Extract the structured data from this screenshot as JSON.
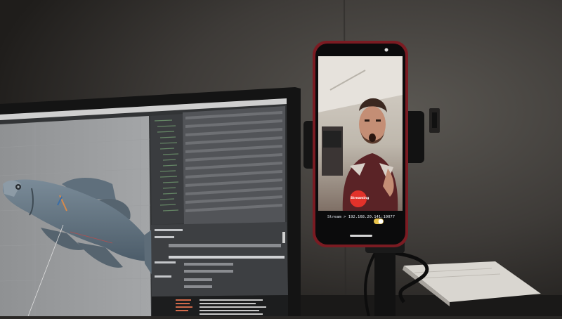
{
  "phone": {
    "stream_text": "Stream > 192.168.20.141:10077",
    "record_label": "Streaming"
  }
}
